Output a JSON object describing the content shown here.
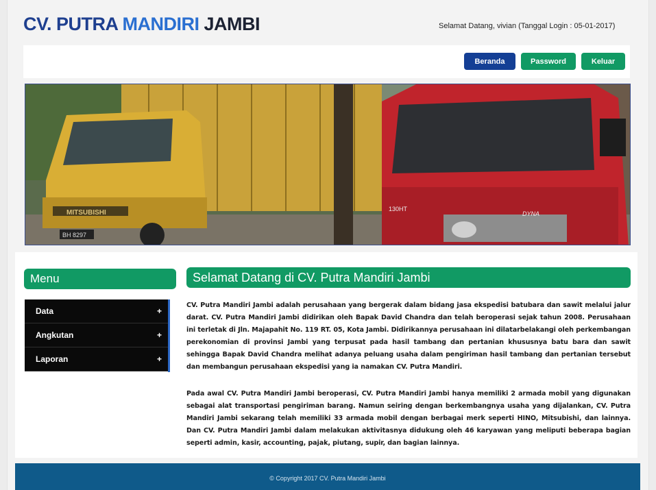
{
  "header": {
    "brand_part1": "CV. PUTRA ",
    "brand_part2": "MANDIRI",
    "brand_part3": " JAMBI",
    "welcome": "Selamat Datang, vivian (Tanggal Login : 05-01-2017)"
  },
  "nav": {
    "beranda": "Beranda",
    "password": "Password",
    "keluar": "Keluar"
  },
  "sidebar": {
    "title": "Menu",
    "items": [
      {
        "label": "Data",
        "icon": "+"
      },
      {
        "label": "Angkutan",
        "icon": "+"
      },
      {
        "label": "Laporan",
        "icon": "+"
      }
    ]
  },
  "main": {
    "title": "Selamat Datang di CV. Putra Mandiri Jambi",
    "paragraph1": "CV. Putra Mandiri Jambi adalah perusahaan yang bergerak dalam bidang jasa ekspedisi batubara dan sawit melalui jalur darat. CV. Putra Mandiri Jambi didirikan oleh Bapak David Chandra dan telah beroperasi sejak tahun 2008. Perusahaan ini terletak di Jln. Majapahit No. 119 RT. 05, Kota Jambi. Didirikannya perusahaan ini dilatarbelakangi oleh perkembangan perekonomian di provinsi Jambi yang terpusat pada hasil tambang dan pertanian khususnya batu bara dan sawit sehingga Bapak David Chandra melihat adanya peluang usaha dalam pengiriman hasil tambang dan pertanian tersebut dan membangun perusahaan ekspedisi yang ia namakan CV. Putra Mandiri.",
    "paragraph2": "Pada awal CV. Putra Mandiri Jambi beroperasi, CV. Putra Mandiri Jambi hanya memiliki 2 armada mobil yang digunakan sebagai alat transportasi pengiriman barang. Namun seiring dengan berkembangnya usaha yang dijalankan, CV. Putra Mandiri Jambi sekarang telah memiliki 33 armada mobil dengan berbagai merk seperti HINO, Mitsubishi, dan lainnya. Dan CV. Putra Mandiri Jambi dalam melakukan aktivitasnya didukung oleh 46 karyawan yang meliputi beberapa bagian seperti admin, kasir, accounting, pajak, piutang, supir, dan bagian lainnya."
  },
  "banner": {
    "plate": "BH 8297",
    "brand_left": "MITSUBISHI",
    "model_right_1": "130HT",
    "model_right_2": "DYNA"
  },
  "footer": {
    "copyright": "© Copyright 2017 CV. Putra Mandiri Jambi"
  },
  "colors": {
    "green": "#119a64",
    "navy": "#143f95",
    "footer": "#0f5a8a"
  }
}
